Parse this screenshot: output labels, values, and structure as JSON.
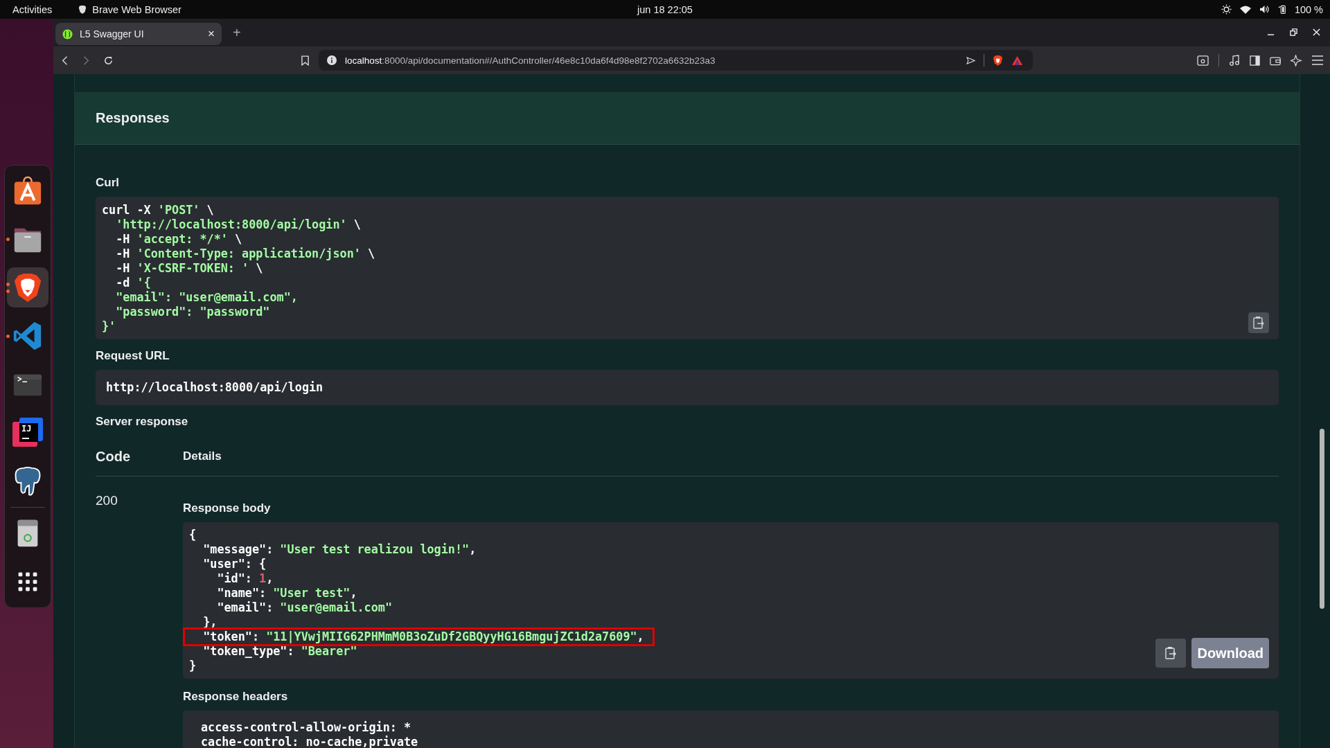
{
  "top_bar": {
    "activities": "Activities",
    "app_name": "Brave Web Browser",
    "clock": "jun 18  22:05",
    "battery": "100 %"
  },
  "dock": [
    {
      "kind": "store",
      "running": false,
      "selected": false
    },
    {
      "kind": "files",
      "running": true,
      "multiple_windows": false,
      "selected": false
    },
    {
      "kind": "brave",
      "running": true,
      "multiple_windows": true,
      "selected": true
    },
    {
      "kind": "vscode",
      "running": true,
      "multiple_windows": false,
      "selected": false
    },
    {
      "kind": "terminal",
      "running": false,
      "selected": false
    },
    {
      "kind": "intellij",
      "running": false,
      "selected": false,
      "text": "IJ"
    },
    {
      "kind": "postgres",
      "running": false,
      "selected": false
    },
    {
      "kind": "trash",
      "running": false,
      "selected": false
    },
    {
      "kind": "apps",
      "running": false,
      "selected": false
    }
  ],
  "browser": {
    "tabs": [
      {
        "title": "L5 Swagger UI",
        "selected": true,
        "close": "×"
      }
    ],
    "new_tab": "+",
    "address": {
      "host": "localhost",
      "rest": ":8000/api/documentation#/AuthController/46e8c10da6f4d98e8f2702a6632b23a3"
    }
  },
  "responses": {
    "title": "Responses",
    "curl": {
      "label": "Curl",
      "lines": [
        [
          {
            "t": "curl -X ",
            "kind": "plain"
          },
          {
            "t": "'POST'",
            "kind": "string"
          },
          {
            "t": " \\",
            "kind": "plain"
          }
        ],
        [
          {
            "t": "  'http://localhost:8000/api/login'",
            "kind": "string"
          },
          {
            "t": " \\",
            "kind": "plain"
          }
        ],
        [
          {
            "t": "  -H ",
            "kind": "plain"
          },
          {
            "t": "'accept: */*'",
            "kind": "string"
          },
          {
            "t": " \\",
            "kind": "plain"
          }
        ],
        [
          {
            "t": "  -H ",
            "kind": "plain"
          },
          {
            "t": "'Content-Type: application/json'",
            "kind": "string"
          },
          {
            "t": " \\",
            "kind": "plain"
          }
        ],
        [
          {
            "t": "  -H ",
            "kind": "plain"
          },
          {
            "t": "'X-CSRF-TOKEN: '",
            "kind": "string"
          },
          {
            "t": " \\",
            "kind": "plain"
          }
        ],
        [
          {
            "t": "  -d ",
            "kind": "plain"
          },
          {
            "t": "'{",
            "kind": "string"
          }
        ],
        [
          {
            "t": "  \"email\": \"user@email.com\",",
            "kind": "string"
          }
        ],
        [
          {
            "t": "  \"password\": \"password\"",
            "kind": "string"
          }
        ],
        [
          {
            "t": "}'",
            "kind": "string"
          }
        ]
      ]
    },
    "request_url": {
      "label": "Request URL",
      "value": "http://localhost:8000/api/login"
    },
    "server_response": {
      "label": "Server response",
      "columns": [
        "Code",
        "Details"
      ],
      "code": "200",
      "body": {
        "label": "Response body",
        "lines": [
          {
            "highlighted": false,
            "parts": [
              {
                "t": "{",
                "kind": "plain"
              }
            ]
          },
          {
            "highlighted": false,
            "parts": [
              {
                "t": "  \"message\": ",
                "kind": "plain"
              },
              {
                "t": "\"User test realizou login!\"",
                "kind": "string"
              },
              {
                "t": ",",
                "kind": "plain"
              }
            ]
          },
          {
            "highlighted": false,
            "parts": [
              {
                "t": "  \"user\": {",
                "kind": "plain"
              }
            ]
          },
          {
            "highlighted": false,
            "parts": [
              {
                "t": "    \"id\": ",
                "kind": "plain"
              },
              {
                "t": "1",
                "kind": "number"
              },
              {
                "t": ",",
                "kind": "plain"
              }
            ]
          },
          {
            "highlighted": false,
            "parts": [
              {
                "t": "    \"name\": ",
                "kind": "plain"
              },
              {
                "t": "\"User test\"",
                "kind": "string"
              },
              {
                "t": ",",
                "kind": "plain"
              }
            ]
          },
          {
            "highlighted": false,
            "parts": [
              {
                "t": "    \"email\": ",
                "kind": "plain"
              },
              {
                "t": "\"user@email.com\"",
                "kind": "string"
              }
            ]
          },
          {
            "highlighted": false,
            "parts": [
              {
                "t": "  },",
                "kind": "plain"
              }
            ]
          },
          {
            "highlighted": true,
            "parts": [
              {
                "t": "  \"token\": ",
                "kind": "plain"
              },
              {
                "t": "\"11|YVwjMIIG62PHMmM0B3oZuDf2GBQyyHG16BmgujZC1d2a7609\"",
                "kind": "string"
              },
              {
                "t": ",",
                "kind": "plain"
              }
            ]
          },
          {
            "highlighted": false,
            "parts": [
              {
                "t": "  \"token_type\": ",
                "kind": "plain"
              },
              {
                "t": "\"Bearer\"",
                "kind": "string"
              }
            ]
          },
          {
            "highlighted": false,
            "parts": [
              {
                "t": "}",
                "kind": "plain"
              }
            ]
          }
        ],
        "download": "Download"
      },
      "headers": {
        "label": "Response headers",
        "lines": [
          "access-control-allow-origin: *",
          "cache-control: no-cache,private"
        ]
      }
    }
  }
}
